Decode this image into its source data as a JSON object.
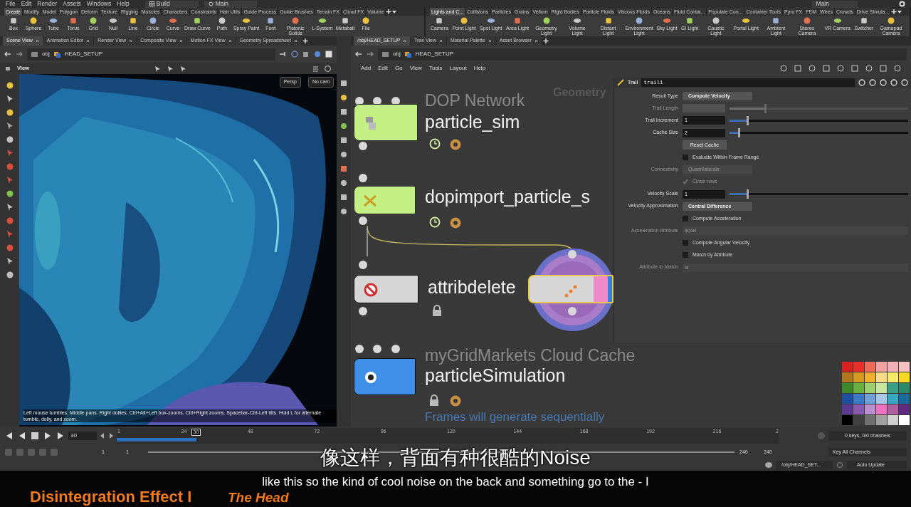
{
  "menu": [
    "File",
    "Edit",
    "Render",
    "Assets",
    "Windows",
    "Help"
  ],
  "desktop": "Build",
  "context": "Main",
  "context_right": "Main",
  "shelf_left": {
    "tabs": [
      {
        "label": "Create",
        "selected": true
      },
      {
        "label": "Modify",
        "selected": false
      },
      {
        "label": "Model",
        "selected": false
      },
      {
        "label": "Polygon",
        "selected": false
      },
      {
        "label": "Deform",
        "selected": false
      },
      {
        "label": "Texture",
        "selected": false
      },
      {
        "label": "Rigging",
        "selected": false
      },
      {
        "label": "Muscles",
        "selected": false
      },
      {
        "label": "Characters",
        "selected": false
      },
      {
        "label": "Constraints",
        "selected": false
      },
      {
        "label": "Hair Utils",
        "selected": false
      },
      {
        "label": "Guide Process",
        "selected": false
      },
      {
        "label": "Guide Brushes",
        "selected": false
      },
      {
        "label": "Terrain FX",
        "selected": false
      },
      {
        "label": "Cloud FX",
        "selected": false
      },
      {
        "label": "Volume",
        "selected": false
      }
    ],
    "tools": [
      "Box",
      "Sphere",
      "Tube",
      "Torus",
      "Grid",
      "Null",
      "Line",
      "Circle",
      "Curve",
      "Draw Curve",
      "Path",
      "Spray Paint",
      "Font",
      "Platonic Solids",
      "L-System",
      "Metaball",
      "File"
    ]
  },
  "shelf_right": {
    "tabs": [
      {
        "label": "Lights and C...",
        "selected": true
      },
      {
        "label": "Collisions",
        "selected": false
      },
      {
        "label": "Particles",
        "selected": false
      },
      {
        "label": "Grains",
        "selected": false
      },
      {
        "label": "Vellum",
        "selected": false
      },
      {
        "label": "Rigid Bodies",
        "selected": false
      },
      {
        "label": "Particle Fluids",
        "selected": false
      },
      {
        "label": "Viscous Fluids",
        "selected": false
      },
      {
        "label": "Oceans",
        "selected": false
      },
      {
        "label": "Fluid Contai...",
        "selected": false
      },
      {
        "label": "Populate Con...",
        "selected": false
      },
      {
        "label": "Container Tools",
        "selected": false
      },
      {
        "label": "Pyro FX",
        "selected": false
      },
      {
        "label": "FEM",
        "selected": false
      },
      {
        "label": "Wires",
        "selected": false
      },
      {
        "label": "Crowds",
        "selected": false
      },
      {
        "label": "Drive Simula...",
        "selected": false
      }
    ],
    "tools": [
      "Camera",
      "Point Light",
      "Spot Light",
      "Area Light",
      "Geometry Light",
      "Volume Light",
      "Distant Light",
      "Environment Light",
      "Sky Light",
      "GI Light",
      "Caustic Light",
      "Portal Light",
      "Ambient Light",
      "Stereo Camera",
      "VR Camera",
      "Switcher",
      "Gamepad Camera"
    ]
  },
  "left_pane": {
    "tabs": [
      {
        "label": "Scene View",
        "selected": true
      },
      {
        "label": "Animation Editor",
        "selected": false
      },
      {
        "label": "Render View",
        "selected": false
      },
      {
        "label": "Composite View",
        "selected": false
      },
      {
        "label": "Motion FX View",
        "selected": false
      },
      {
        "label": "Geometry Spreadsheet",
        "selected": false
      }
    ],
    "path": [
      "obj",
      "HEAD_SETUP"
    ],
    "view_title": "View",
    "camera": "Persp",
    "cam_menu": "No cam",
    "hint": "Left mouse tumbles. Middle pans. Right dollies. Ctrl+Alt+Left box-zooms. Ctrl+Right zooms. Spacebar-Ctrl-Left tilts. Hold L for alternate tumble, dolly, and zoom."
  },
  "right_pane": {
    "tabs": [
      {
        "label": "/obj/HEAD_SETUP",
        "selected": true
      },
      {
        "label": "Tree View",
        "selected": false
      },
      {
        "label": "Material Palette",
        "selected": false
      },
      {
        "label": "Asset Browser",
        "selected": false
      }
    ],
    "path": [
      "obj",
      "HEAD_SETUP"
    ],
    "menu": [
      "Add",
      "Edit",
      "Go",
      "View",
      "Tools",
      "Layout",
      "Help"
    ],
    "context_label": "Geometry"
  },
  "nodes": [
    {
      "kind": "dop",
      "header": "DOP Network",
      "name": "particle_sim",
      "color": "#c4ef84",
      "locked": false,
      "selected": false
    },
    {
      "kind": "import",
      "name": "dopimport_particle_s",
      "color": "#c4ef84",
      "locked": false,
      "selected": false
    },
    {
      "kind": "delete",
      "name": "attribdelete",
      "color": "#d6d6d6",
      "locked": true,
      "selected": false
    },
    {
      "kind": "trail",
      "color": "#d6d6d6",
      "locked": false,
      "selected": true
    },
    {
      "kind": "cache",
      "header": "myGridMarkets Cloud Cache",
      "name": "particleSimulation",
      "color": "#3f8fe8",
      "locked": true,
      "selected": false,
      "note": "Frames will generate sequentially"
    }
  ],
  "params": {
    "type": "Trail",
    "name": "trail1",
    "rows": [
      {
        "kind": "menu",
        "label": "Result Type",
        "value": "Compute Velocity",
        "disabled": false
      },
      {
        "kind": "slider",
        "label": "Trail Length",
        "level": 0.2,
        "disabled": true
      },
      {
        "kind": "slider",
        "label": "Trail Increment",
        "value": "1",
        "level": 0.1,
        "disabled": false
      },
      {
        "kind": "slider",
        "label": "Cache Size",
        "value": "2",
        "level": 0.05,
        "disabled": false
      },
      {
        "kind": "button",
        "label": "Reset Cache"
      },
      {
        "kind": "checkbox",
        "label": "Evaluate Within Frame Range",
        "checked": false,
        "disabled": false
      },
      {
        "kind": "menu",
        "label": "Connectivity",
        "value": "Quadrilaterals",
        "disabled": true
      },
      {
        "kind": "checkbox",
        "label": "Close rows",
        "checked": true,
        "disabled": true
      },
      {
        "kind": "slider",
        "label": "Velocity Scale",
        "value": "1",
        "level": 0.1,
        "disabled": false
      },
      {
        "kind": "menu",
        "label": "Velocity Approximation",
        "value": "Central Difference",
        "disabled": false
      },
      {
        "kind": "checkbox",
        "label": "Compute Acceleration",
        "checked": false,
        "disabled": false
      },
      {
        "kind": "field",
        "label": "Acceleration Attribute",
        "value": "accel",
        "disabled": true
      },
      {
        "kind": "checkbox",
        "label": "Compute Angular Velocity",
        "checked": false,
        "disabled": false
      },
      {
        "kind": "checkbox",
        "label": "Match by Attribute",
        "checked": false,
        "disabled": false
      },
      {
        "kind": "field",
        "label": "Attribute to Match",
        "value": "id",
        "disabled": true
      }
    ]
  },
  "palette": [
    {
      "color": "#d92020"
    },
    {
      "color": "#e8302a"
    },
    {
      "color": "#ee6a5a"
    },
    {
      "color": "#f3a0a0"
    },
    {
      "color": "#f4b0b8"
    },
    {
      "color": "#f7c0c0"
    },
    {
      "color": "#b0781a"
    },
    {
      "color": "#d69a20"
    },
    {
      "color": "#f0b030"
    },
    {
      "color": "#f8dc8a"
    },
    {
      "color": "#f8e86a"
    },
    {
      "color": "#f8d820"
    },
    {
      "color": "#3c8a2a"
    },
    {
      "color": "#6ab040"
    },
    {
      "color": "#9ed070"
    },
    {
      "color": "#c8e8a0"
    },
    {
      "color": "#3aa088"
    },
    {
      "color": "#2a8a6a"
    },
    {
      "color": "#1c50a0"
    },
    {
      "color": "#3a78c8"
    },
    {
      "color": "#70a0d8"
    },
    {
      "color": "#a8c8ec"
    },
    {
      "color": "#38a8c0"
    },
    {
      "color": "#1a6aa0"
    },
    {
      "color": "#5a3a90"
    },
    {
      "color": "#8a5ab0"
    },
    {
      "color": "#b890d0"
    },
    {
      "color": "#f070c0"
    },
    {
      "color": "#b060a0"
    },
    {
      "color": "#602a80"
    },
    {
      "color": "#000000"
    },
    {
      "color": "#404040"
    },
    {
      "color": "#707070"
    },
    {
      "color": "#a0a0a0"
    },
    {
      "color": "#d0d0d0"
    },
    {
      "color": "#ffffff"
    }
  ],
  "timeline": {
    "frame": "30",
    "current": "30",
    "level": 0.12,
    "ticks": [
      "1",
      "24",
      "48",
      "72",
      "96",
      "120",
      "144",
      "168",
      "192",
      "216",
      "2"
    ],
    "start": "1",
    "start2": "1",
    "end": "240",
    "end2": "240",
    "keys": "0 keys, 0/0 channels",
    "key_mode": "Key All Channels",
    "status_path": "/obj/HEAD_SET...",
    "update": "Auto Update"
  },
  "subtitles": {
    "zh": "像这样，背面有种很酷的Noise",
    "en": "like this so the kind of cool noise on the back and something go to the - I"
  },
  "course": {
    "title": "Disintegration Effect I",
    "subtitle": "The Head"
  }
}
